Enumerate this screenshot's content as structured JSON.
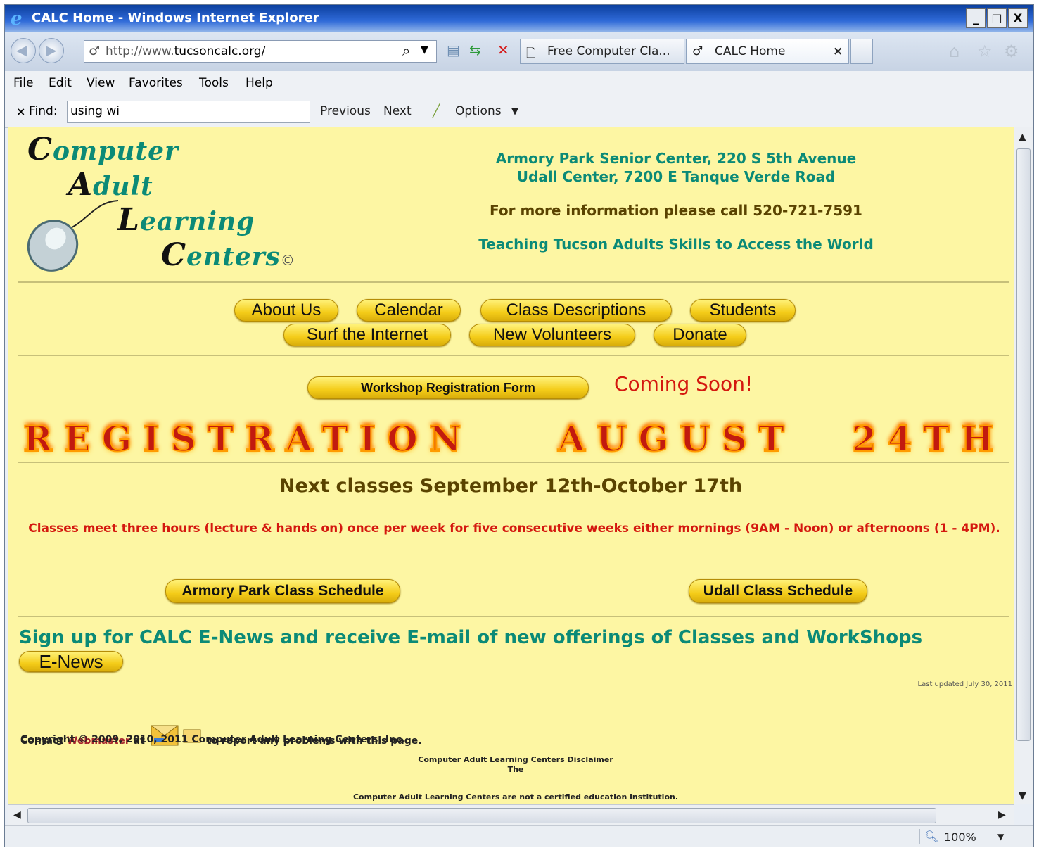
{
  "window": {
    "title": "CALC Home - Windows Internet Explorer",
    "controls": [
      "_",
      "□",
      "X"
    ]
  },
  "address": {
    "url_prefix": "http://www.",
    "url_host": "tucsoncalc.org/",
    "tabs": [
      {
        "label": "Free Computer Cla..."
      },
      {
        "label": "CALC Home",
        "close": "×"
      }
    ]
  },
  "menu": {
    "items": [
      "File",
      "Edit",
      "View",
      "Favorites",
      "Tools",
      "Help"
    ]
  },
  "find": {
    "close": "×",
    "label": "Find:",
    "value": "using wi",
    "previous": "Previous",
    "next": "Next",
    "options": "Options"
  },
  "page": {
    "logo": {
      "line1_cap": "C",
      "line1": "omputer",
      "line2_cap": "A",
      "line2": "dult",
      "line3_cap": "L",
      "line3": "earning",
      "line4_cap": "C",
      "line4": "enters",
      "copyright_mark": "©"
    },
    "address1": "Armory Park Senior Center, 220 S 5th Avenue",
    "address2": "Udall Center, 7200 E Tanque Verde Road",
    "phone_line": "For more information please call 520-721-7591",
    "tagline": "Teaching Tucson Adults Skills to Access the World",
    "nav": [
      "About Us",
      "Calendar",
      "Class Descriptions",
      "Students",
      "Surf the Internet",
      "New Volunteers",
      "Donate"
    ],
    "workshop_button": "Workshop Registration Form",
    "coming_soon": "Coming Soon!",
    "banner_words": [
      "REGISTRATION",
      "AUGUST",
      "24TH"
    ],
    "next_classes": "Next classes September 12th-October 17th",
    "schedule_note": "Classes meet three hours (lecture & hands on) once per week for five consecutive weeks either mornings (9AM - Noon) or afternoons (1 - 4PM).",
    "armory_button": "Armory Park Class Schedule",
    "udall_button": "Udall Class Schedule",
    "enews_text": "Sign up for CALC E-News and receive E-mail of new offerings of Classes and WorkShops",
    "enews_button": "E-News",
    "last_updated": "Last updated July 30, 2011",
    "contact_prefix": "Contact",
    "contact_link": "Webmaster",
    "contact_at": "at",
    "contact_suffix": "to report any problems with this page.",
    "copyright": "Copyright © 2009, 2010, 2011 Computer Adult Learning Centers, Inc.",
    "disclaimer_title": "Computer Adult Learning Centers Disclaimer",
    "disclaimer_the": "The",
    "disclaimer_text": "Computer Adult Learning Centers are not a certified education institution."
  },
  "status": {
    "zoom": "100%"
  },
  "colors": {
    "page_bg": "#fdf6a3",
    "teal_text": "#0b8a77",
    "red_text": "#d4180f",
    "dark_text": "#5a4300",
    "pill_yellow": "#f4cc19"
  }
}
